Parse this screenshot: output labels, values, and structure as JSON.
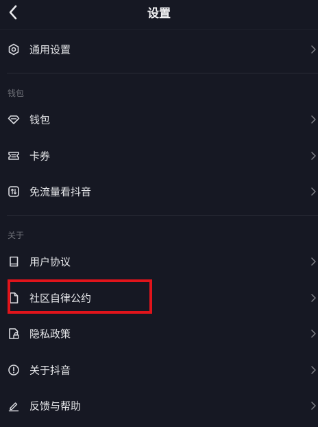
{
  "header": {
    "title": "设置",
    "back_icon": "chevron-left-icon"
  },
  "general": {
    "items": [
      {
        "label": "通用设置",
        "icon": "hexagon-settings-icon"
      }
    ]
  },
  "wallet_section": {
    "title": "钱包",
    "items": [
      {
        "label": "钱包",
        "icon": "diamond-icon"
      },
      {
        "label": "卡券",
        "icon": "ticket-icon"
      },
      {
        "label": "免流量看抖音",
        "icon": "data-free-icon"
      }
    ]
  },
  "about_section": {
    "title": "关于",
    "items": [
      {
        "label": "用户协议",
        "icon": "book-icon"
      },
      {
        "label": "社区自律公约",
        "icon": "document-icon"
      },
      {
        "label": "隐私政策",
        "icon": "privacy-lock-icon"
      },
      {
        "label": "关于抖音",
        "icon": "info-circle-icon"
      },
      {
        "label": "反馈与帮助",
        "icon": "edit-pen-icon"
      }
    ]
  },
  "highlight": {
    "color": "#e0141b",
    "target": "社区自律公约"
  },
  "colors": {
    "background": "#161823",
    "text": "#e6e7ea",
    "muted": "#6f7178",
    "divider": "#2a2c37"
  }
}
